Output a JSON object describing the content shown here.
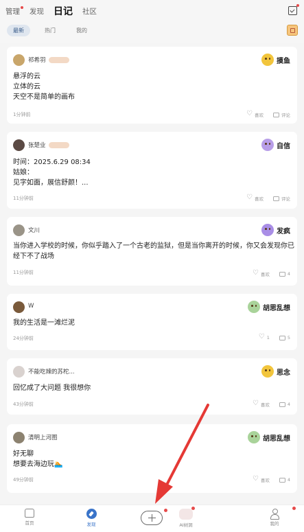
{
  "header": {
    "tabs": [
      {
        "label": "管理"
      },
      {
        "label": "发现"
      },
      {
        "label": "日记"
      },
      {
        "label": "社区"
      }
    ],
    "subtabs": [
      {
        "label": "最新"
      },
      {
        "label": "热门"
      },
      {
        "label": "我的"
      }
    ]
  },
  "posts": [
    {
      "user": "祁希羽",
      "avatar_color": "#c9a66b",
      "mood": "摸鱼",
      "mood_color": "#f2c53c",
      "lines": [
        "悬浮的云",
        "立体的云",
        "天空不是简单的画布"
      ],
      "time": "1分钟前",
      "like_label": "喜欢",
      "comment_label": "评论"
    },
    {
      "user": "张楚业",
      "avatar_color": "#5b4a44",
      "mood": "自信",
      "mood_color": "#b89ee8",
      "lines": [
        "时间：2025.6.29 08:34",
        "姑娘：",
        "    见字如面，展信舒颜！..."
      ],
      "time": "11分钟前",
      "like_label": "喜欢",
      "comment_label": "评论"
    },
    {
      "user": "文川",
      "avatar_color": "#9a9488",
      "mood": "发疯",
      "mood_color": "#a98ee6",
      "lines": [
        "当你进入学校的时候，你似乎踏入了一个古老的监狱，但是当你离开的时候，你又会发现你已",
        "经下不了战场"
      ],
      "time": "11分钟前",
      "like_label": "喜欢",
      "comment_label": "4"
    },
    {
      "user": "W",
      "avatar_color": "#7a5a3b",
      "mood": "胡思乱想",
      "mood_color": "#a9d39a",
      "lines": [
        "我的生活是一滩烂泥"
      ],
      "time": "24分钟前",
      "like_label": "1",
      "comment_label": "5"
    },
    {
      "user": "不能吃辣的苏柁...",
      "avatar_color": "#d9d2cf",
      "mood": "思念",
      "mood_color": "#f2c53c",
      "lines": [
        "回忆成了大问题  我很想你"
      ],
      "time": "43分钟前",
      "like_label": "喜欢",
      "comment_label": "4"
    },
    {
      "user": "清明上河图",
      "avatar_color": "#8c8270",
      "mood": "胡思乱想",
      "mood_color": "#a9d39a",
      "lines": [
        "好无聊",
        "想要去海边玩🏊"
      ],
      "time": "49分钟前",
      "like_label": "喜欢",
      "comment_label": "4"
    }
  ],
  "navbar": {
    "home": "首页",
    "discover": "发现",
    "ai": "AI树洞",
    "profile": "我的"
  }
}
